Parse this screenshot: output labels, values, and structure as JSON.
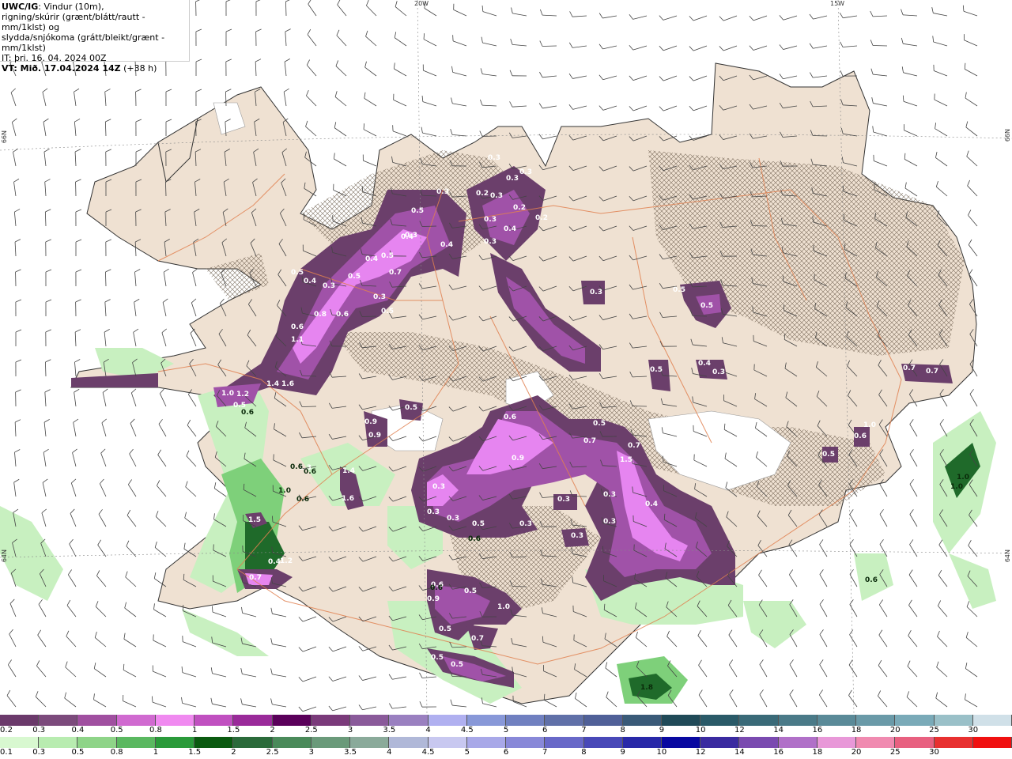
{
  "header": {
    "title_bold": "UWC/IG",
    "title_rest": ": Vindur (10m),",
    "line2": "rigning/skúrir (grænt/blátt/rautt - mm/1klst) og",
    "line3": "slydda/snjókoma (grátt/bleikt/grænt - mm/1klst)",
    "init_time": "IT: þri. 16. 04. 2024 00Z",
    "valid_label": "VT: Mið. 17.04.2024 14Z",
    "valid_offset": "(+38 h)"
  },
  "gridlabels": {
    "lon_20w": "20W",
    "lon_15w": "15W",
    "lat_66n_left": "66N",
    "lat_66n_right": "66N",
    "lat_64n_left": "64N",
    "lat_64n_right": "64N"
  },
  "map_labels": {
    "snow_values": [
      "0.3",
      "0.3",
      "0.3",
      "0.2",
      "0.3",
      "0.2",
      "0.2",
      "0.3",
      "0.3",
      "0.4",
      "0.3",
      "0.4",
      "0.5",
      "0.4",
      "0.5",
      "0.3",
      "0.4",
      "0.5",
      "0.7",
      "0.3",
      "0.5",
      "0.5",
      "0.4",
      "0.3",
      "0.6",
      "0.8",
      "0.6",
      "1.1",
      "1.4",
      "1.6",
      "1.2",
      "1.0",
      "0.5",
      "0.5",
      "0.6",
      "0.9",
      "0.7",
      "0.7",
      "1.5",
      "0.5",
      "0.4",
      "0.3",
      "0.3",
      "0.3",
      "0.3",
      "0.5",
      "0.3",
      "0.3",
      "0.3",
      "0.3",
      "0.3",
      "0.5",
      "0.5",
      "0.5",
      "0.4",
      "0.3",
      "0.7",
      "0.7",
      "0.6",
      "0.5",
      "1.0",
      "0.9",
      "0.9",
      "1.4",
      "1.6",
      "1.3",
      "1.2",
      "0.4",
      "0.7",
      "1.5",
      "0.6",
      "0.9",
      "0.5",
      "1.0",
      "0.5",
      "0.7",
      "0.5",
      "0.5"
    ],
    "rain_values": [
      "0.6",
      "0.6",
      "1.0",
      "0.6",
      "0.6",
      "0.6",
      "1.0",
      "1.0",
      "0.6",
      "1.8",
      "0.6"
    ]
  },
  "colorbar_snow": {
    "ticks": [
      "0.2",
      "0.3",
      "0.4",
      "0.5",
      "0.8",
      "1",
      "1.5",
      "2",
      "2.5",
      "3",
      "3.5",
      "4",
      "4.5",
      "5",
      "6",
      "7",
      "8",
      "9",
      "10",
      "12",
      "14",
      "16",
      "18",
      "20",
      "25",
      "30"
    ],
    "colors": [
      "#6b3a6b",
      "#7c4a7c",
      "#a04fa0",
      "#d06ad0",
      "#f08af0",
      "#c050c0",
      "#9a2a9a",
      "#5a005a",
      "#7a3a7a",
      "#8a5a9a",
      "#9a80c0",
      "#b0b0f0",
      "#8898d8",
      "#7080c0",
      "#6070a8",
      "#506098",
      "#3a5a78",
      "#204a58",
      "#2a5a68",
      "#3a6a78",
      "#4a7a88",
      "#5a8a98",
      "#6a9aa8",
      "#7aaab8",
      "#9ac0c8",
      "#d0e0e8"
    ]
  },
  "colorbar_rain": {
    "ticks": [
      "0.1",
      "0.3",
      "0.5",
      "0.8",
      "1",
      "1.5",
      "2",
      "2.5",
      "3",
      "3.5",
      "4",
      "4.5",
      "5",
      "6",
      "7",
      "8",
      "9",
      "10",
      "12",
      "14",
      "16",
      "18",
      "20",
      "25",
      "30"
    ],
    "colors": [
      "#d8f8d0",
      "#b8ecb0",
      "#8ed488",
      "#5ab860",
      "#2a9a3a",
      "#0a5a10",
      "#2a6a3a",
      "#4a8a5a",
      "#6a9a7a",
      "#8aaa9a",
      "#b0b8d8",
      "#c8c8f0",
      "#a8a8e8",
      "#8888d8",
      "#6868c8",
      "#4848b8",
      "#2828a8",
      "#0808a0",
      "#3a2aa0",
      "#7a4ab0",
      "#b070c8",
      "#e898d8",
      "#f08ab0",
      "#e86080",
      "#e83030",
      "#f01010"
    ]
  },
  "colors": {
    "land": "#efe1d2",
    "sea": "#ffffff",
    "roads": "#e08050",
    "coast": "#333333",
    "snow_dark": "#6b3f6b",
    "snow_mid": "#a052a8",
    "snow_light": "#e685f0",
    "rain_light": "#c8f0c0",
    "rain_mid": "#7ed07a",
    "rain_dark": "#1f6a2a"
  }
}
